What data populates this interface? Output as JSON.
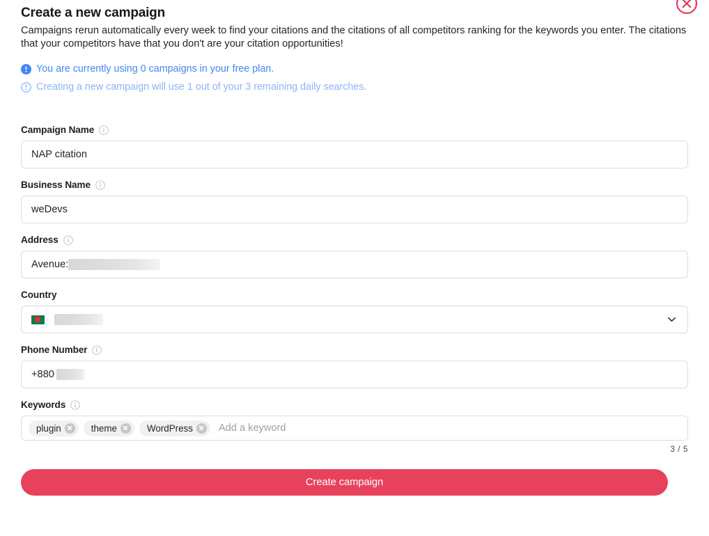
{
  "dialog": {
    "title": "Create a new campaign",
    "subtitle": "Campaigns rerun automatically every week to find your citations and the citations of all competitors ranking for the keywords you enter. The citations that your competitors have that you don't are your citation opportunities!",
    "close_icon": "close-circle-icon"
  },
  "notices": [
    {
      "icon": "info-filled-icon",
      "text": "You are currently using 0 campaigns in your free plan.",
      "color": "#4285f4"
    },
    {
      "icon": "info-outline-icon",
      "text": "Creating a new campaign will use 1 out of your 3 remaining daily searches.",
      "color": "#8ab4f8"
    }
  ],
  "form": {
    "campaign_name": {
      "label": "Campaign Name",
      "info_icon": "info-circle-icon",
      "value": "NAP citation"
    },
    "business_name": {
      "label": "Business Name",
      "info_icon": "info-circle-icon",
      "value": "weDevs"
    },
    "address": {
      "label": "Address",
      "info_icon": "info-circle-icon",
      "value": "Avenue:"
    },
    "country": {
      "label": "Country",
      "flag_icon": "bangladesh-flag-icon",
      "value": "",
      "chevron_icon": "chevron-down-icon"
    },
    "phone": {
      "label": "Phone Number",
      "info_icon": "info-circle-icon",
      "value": "+880"
    },
    "keywords": {
      "label": "Keywords",
      "info_icon": "info-circle-icon",
      "chips": [
        {
          "label": "plugin",
          "remove_icon": "chip-remove-icon"
        },
        {
          "label": "theme",
          "remove_icon": "chip-remove-icon"
        },
        {
          "label": "WordPress",
          "remove_icon": "chip-remove-icon"
        }
      ],
      "placeholder": "Add a keyword",
      "counter": "3 / 5"
    }
  },
  "submit": {
    "label": "Create campaign",
    "color": "#e8415b"
  }
}
